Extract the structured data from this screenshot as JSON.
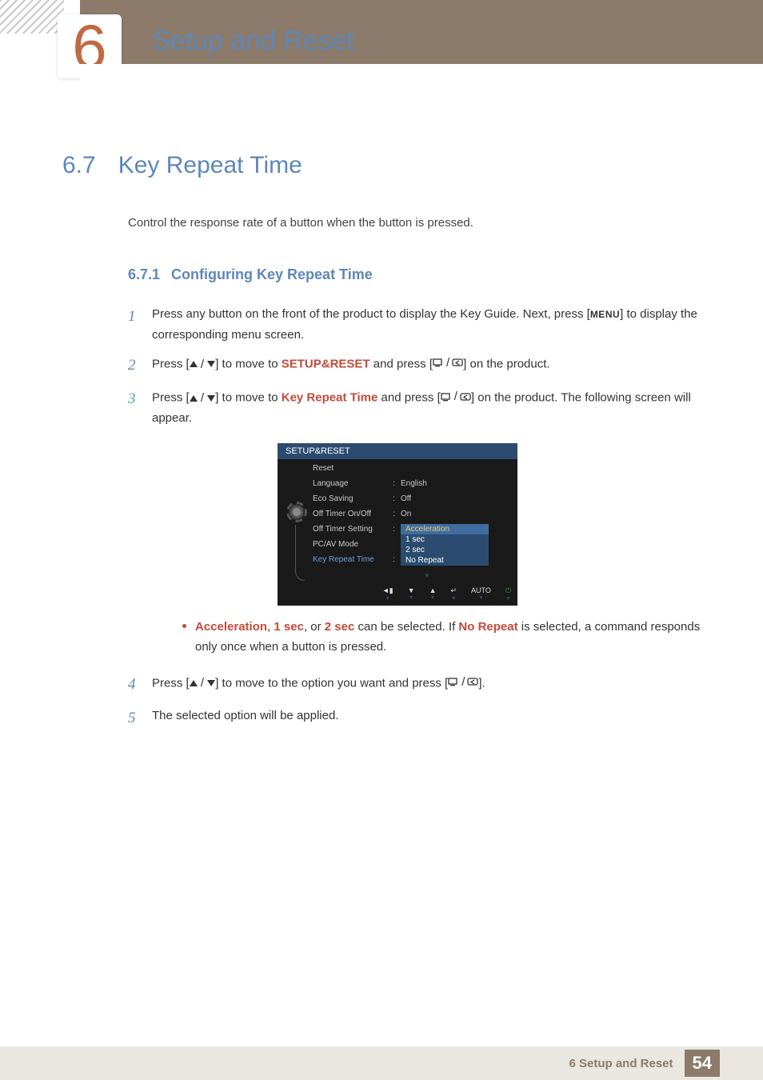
{
  "chapter": {
    "number": "6",
    "title": "Setup and Reset"
  },
  "section": {
    "number": "6.7",
    "title": "Key Repeat Time"
  },
  "intro": "Control the response rate of a button when the button is pressed.",
  "subsection": {
    "number": "6.7.1",
    "title": "Configuring Key Repeat Time"
  },
  "steps": {
    "s1a": "Press any button on the front of the product to display the Key Guide. Next, press [",
    "s1b": "] to display the corresponding menu screen.",
    "menu_label": "MENU",
    "s2a": "Press [",
    "s2b": "] to move to ",
    "s2_target": "SETUP&RESET",
    "s2c": " and press [",
    "s2d": "] on the product.",
    "s3a": "Press [",
    "s3b": "] to move to ",
    "s3_target": "Key Repeat Time",
    "s3c": " and press [",
    "s3d": "] on the product. The following screen will appear.",
    "s4a": "Press [",
    "s4b": "] to move to the option you want and press [",
    "s4c": "].",
    "s5": "The selected option will be applied."
  },
  "osd": {
    "title": "SETUP&RESET",
    "rows": [
      {
        "label": "Reset",
        "val": ""
      },
      {
        "label": "Language",
        "val": "English"
      },
      {
        "label": "Eco Saving",
        "val": "Off"
      },
      {
        "label": "Off Timer On/Off",
        "val": "On"
      },
      {
        "label": "Off Timer Setting",
        "val": ""
      },
      {
        "label": "PC/AV Mode",
        "val": ""
      },
      {
        "label": "Key Repeat Time",
        "val": ""
      }
    ],
    "dropdown": [
      "Acceleration",
      "1 sec",
      "2 sec",
      "No Repeat"
    ],
    "footer_auto": "AUTO"
  },
  "note": {
    "opt1": "Acceleration",
    "sep1": ", ",
    "opt2": "1 sec",
    "sep2": ", or ",
    "opt3": "2 sec",
    "mid": " can be selected. If ",
    "opt4": "No Repeat",
    "tail": " is selected, a command responds only once when a button is pressed."
  },
  "footer": {
    "text": "6 Setup and Reset",
    "page": "54"
  }
}
